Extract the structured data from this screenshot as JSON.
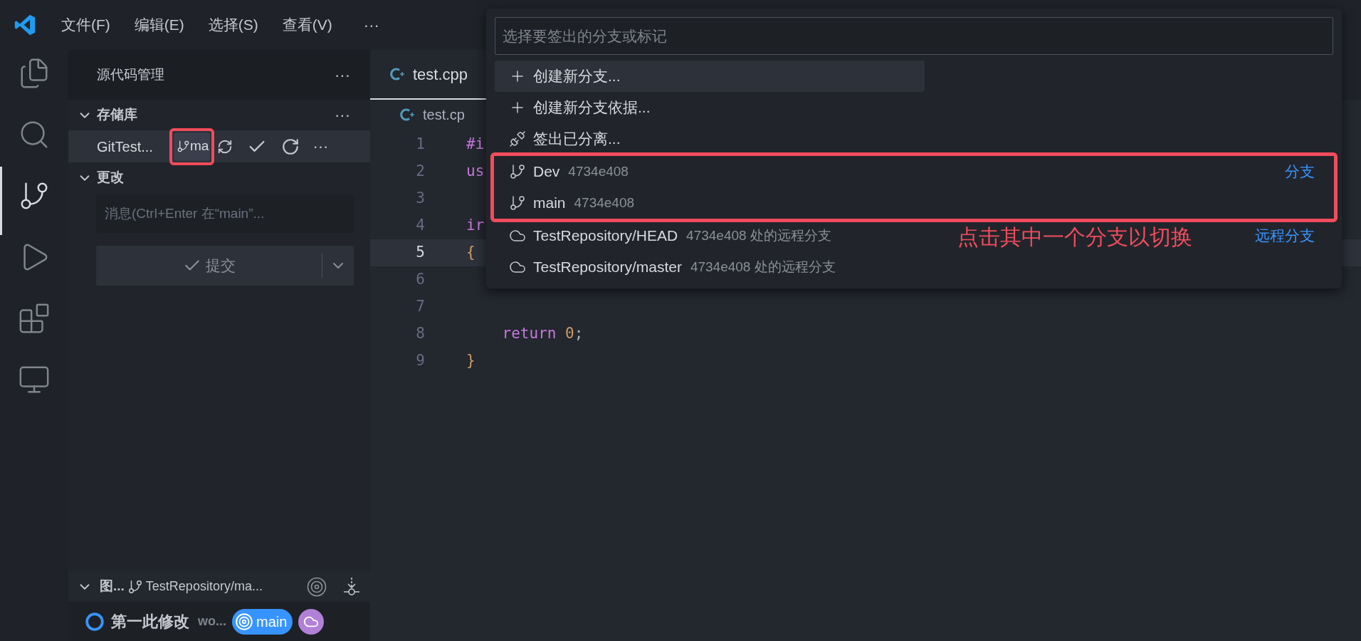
{
  "menu_bar": {
    "items": [
      "文件(F)",
      "编辑(E)",
      "选择(S)",
      "查看(V)"
    ],
    "more": "···"
  },
  "activity_bar": {
    "items": [
      {
        "kind": "explorer",
        "selected": false
      },
      {
        "kind": "search",
        "selected": false
      },
      {
        "kind": "scm",
        "selected": true
      },
      {
        "kind": "run",
        "selected": false
      },
      {
        "kind": "extensions",
        "selected": false
      },
      {
        "kind": "remote",
        "selected": false
      }
    ]
  },
  "sidebar": {
    "title": "源代码管理",
    "more": "···",
    "repositories": {
      "title": "存储库",
      "expanded": true,
      "more": "···",
      "repo": {
        "name": "GitTest...",
        "branch": "ma",
        "more": "···"
      }
    },
    "changes": {
      "title": "更改",
      "expanded": true,
      "message_placeholder": "消息(Ctrl+Enter 在“main”...",
      "commit_button": "提交"
    },
    "graph": {
      "title": "图...",
      "expanded": true,
      "branch": "TestRepository/ma...",
      "commit": {
        "message": "第一此修改",
        "author": "wo...",
        "badge": "main"
      }
    }
  },
  "editor": {
    "tab": {
      "label": "test.cpp",
      "selected": true
    },
    "breadcrumb": "test.cp",
    "lines": [
      {
        "number": "1",
        "current": false,
        "tokens": [
          {
            "text": "#i",
            "kind": "keyword"
          }
        ]
      },
      {
        "number": "2",
        "current": false,
        "tokens": [
          {
            "text": "us",
            "kind": "keyword"
          }
        ]
      },
      {
        "number": "3",
        "current": false
      },
      {
        "number": "4",
        "current": false,
        "tokens": [
          {
            "text": "ir",
            "kind": "keyword"
          }
        ]
      },
      {
        "number": "5",
        "current": true,
        "tokens": [
          {
            "text": "{",
            "kind": "brace"
          }
        ]
      },
      {
        "number": "6",
        "current": false
      },
      {
        "number": "7",
        "current": false
      },
      {
        "number": "8",
        "current": false,
        "tokens": [
          {
            "text": "    return",
            "kind": "keyword"
          },
          {
            "text": " 0",
            "kind": "number"
          },
          {
            "text": ";",
            "kind": "plain"
          }
        ]
      },
      {
        "number": "9",
        "current": false,
        "tokens": [
          {
            "text": "}",
            "kind": "brace"
          }
        ]
      }
    ]
  },
  "quick_pick": {
    "placeholder": "选择要签出的分支或标记",
    "items": [
      {
        "kind": "create",
        "label": "创建新分支...",
        "selected": true
      },
      {
        "kind": "create",
        "label": "创建新分支依据...",
        "selected": false
      },
      {
        "kind": "detached",
        "label": "签出已分离...",
        "selected": false
      },
      {
        "kind": "branch",
        "label": "Dev",
        "detail": "4734e408",
        "group": "分支",
        "selected": false
      },
      {
        "kind": "branch",
        "label": "main",
        "detail": "4734e408",
        "selected": false
      },
      {
        "kind": "remote",
        "label": "TestRepository/HEAD",
        "detail": "4734e408 处的远程分支",
        "group": "远程分支",
        "selected": false
      },
      {
        "kind": "remote",
        "label": "TestRepository/master",
        "detail": "4734e408 处的远程分支",
        "selected": false
      }
    ]
  },
  "annotation": {
    "text": "点击其中一个分支以切换"
  }
}
